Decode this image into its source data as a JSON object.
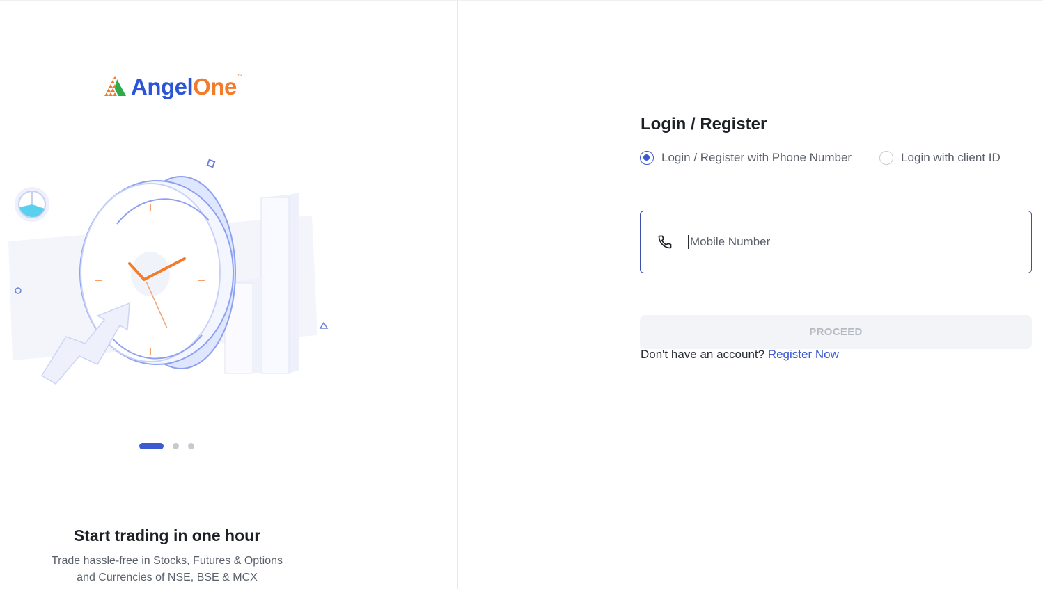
{
  "logo": {
    "angel": "Angel",
    "one": "One",
    "tm": "™"
  },
  "carousel": {
    "slide_title": "Start trading in one hour",
    "slide_desc_line1": "Trade hassle-free in Stocks, Futures & Options",
    "slide_desc_line2": "and Currencies of NSE, BSE & MCX",
    "active_slide": 1,
    "total_slides": 3
  },
  "form": {
    "title": "Login / Register",
    "options": [
      {
        "label": "Login / Register with Phone Number",
        "checked": true
      },
      {
        "label": "Login with client ID",
        "checked": false
      }
    ],
    "mobile_placeholder": "Mobile Number",
    "mobile_value": "",
    "proceed_label": "PROCEED",
    "no_account_text": "Don't have an account?",
    "register_link": "Register Now"
  },
  "colors": {
    "brand_blue": "#3d5ad1",
    "brand_orange": "#f27c2b",
    "logo_green": "#2eaa4a"
  },
  "icons": [
    "angelone-logo-icon",
    "phone-icon",
    "radio-checked",
    "radio-unchecked"
  ]
}
